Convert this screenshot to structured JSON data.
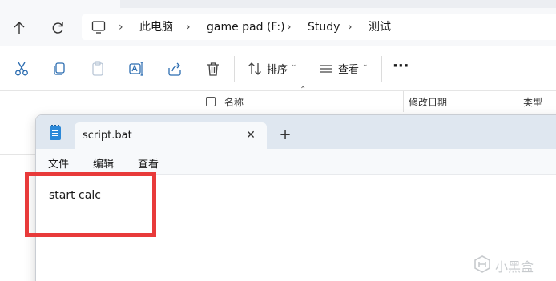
{
  "explorer": {
    "breadcrumb": [
      "此电脑",
      "game pad (F:)",
      "Study",
      "测试"
    ],
    "toolbar": {
      "sort_label": "排序",
      "view_label": "查看",
      "more_label": "···"
    },
    "columns": [
      "名称",
      "修改日期",
      "类型"
    ]
  },
  "notepad": {
    "tab_title": "script.bat",
    "menu": [
      "文件",
      "编辑",
      "查看"
    ],
    "content": "start calc"
  },
  "watermark": {
    "text": "小黑盒"
  },
  "colors": {
    "highlight": "#e83a3a",
    "notepad_icon": "#2b88d8"
  }
}
